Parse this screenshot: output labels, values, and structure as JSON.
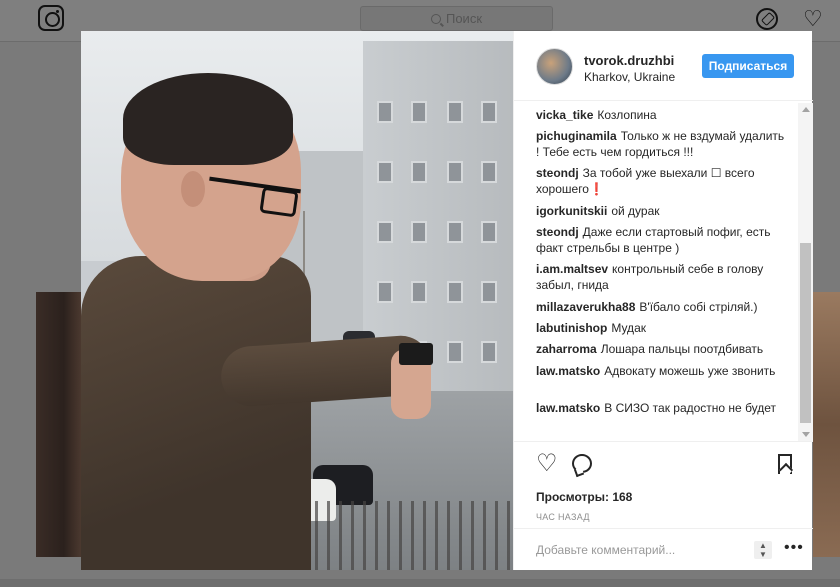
{
  "nav": {
    "search_placeholder": "Поиск",
    "icons": [
      "instagram-logo-icon",
      "search-icon",
      "compass-icon",
      "heart-icon"
    ]
  },
  "post": {
    "username": "tvorok.druzhbi",
    "location": "Kharkov, Ukraine",
    "follow_label": "Подписаться",
    "comments": [
      {
        "user": "vicka_tike",
        "text": "Козлопина"
      },
      {
        "user": "pichuginamila",
        "text": "Только ж не вздумай удалить ! Тебе есть чем гордиться !!!"
      },
      {
        "user": "steondj",
        "text": "За тобой уже выехали ☐ всего хорошего❗"
      },
      {
        "user": "igorkunitskii",
        "text": "ой дурак"
      },
      {
        "user": "steondj",
        "text": "Даже если стартовый пофиг, есть факт стрельбы в центре )"
      },
      {
        "user": "i.am.maltsev",
        "text": "контрольный себе в голову забыл, гнида"
      },
      {
        "user": "millazaverukha88",
        "text": "В'їбало собі стріляй.)"
      },
      {
        "user": "labutinishop",
        "text": "Мудак"
      },
      {
        "user": "zaharroma",
        "text": "Лошара пальцы поотдбивать"
      },
      {
        "user": "law.matsko",
        "text": "Адвокату можешь уже звонить"
      },
      {
        "user": "law.matsko",
        "text": "В СИЗО так радостно не будет"
      }
    ],
    "views_label": "Просмотры: 168",
    "time_label": "ЧАС НАЗАД",
    "add_comment_placeholder": "Добавьте комментарий...",
    "more_label": "•••"
  },
  "colors": {
    "accent": "#3897f0",
    "text": "#262626",
    "muted": "#8e8e8e",
    "overlay": "#7a7a7a"
  }
}
